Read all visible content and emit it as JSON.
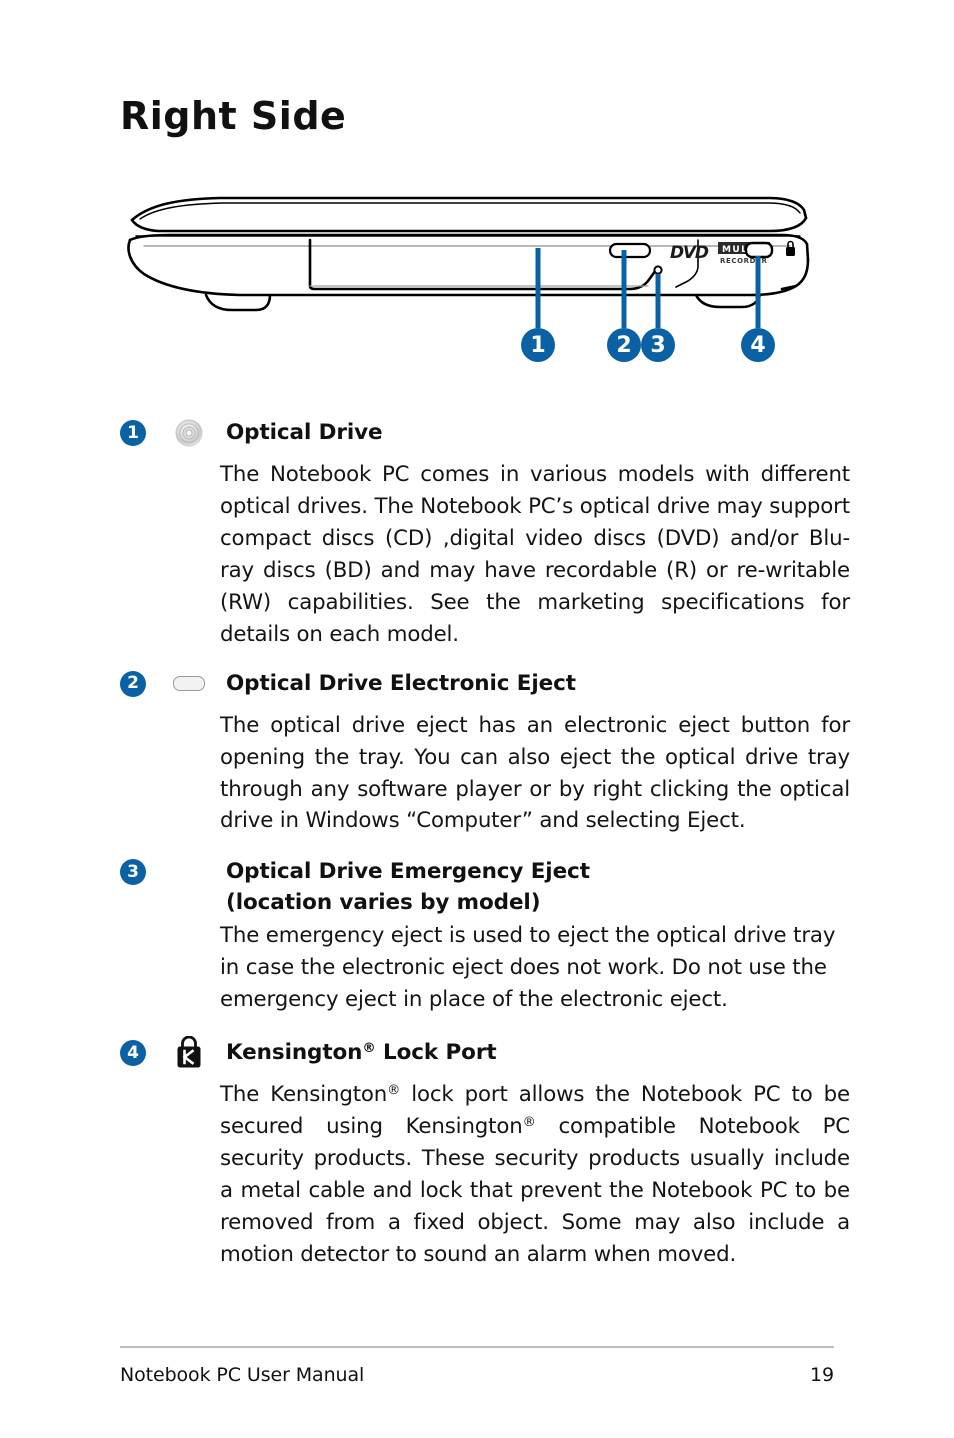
{
  "page": {
    "title": "Right Side"
  },
  "illustration": {
    "name": "notebook-right-side-diagram",
    "drive_logo_primary": "DVD",
    "drive_logo_secondary": "MULTI",
    "drive_logo_tertiary": "RECORDER",
    "callouts": [
      {
        "number": "1",
        "target": "optical-drive"
      },
      {
        "number": "2",
        "target": "optical-drive-electronic-eject"
      },
      {
        "number": "3",
        "target": "optical-drive-emergency-eject"
      },
      {
        "number": "4",
        "target": "kensington-lock-port"
      }
    ],
    "accent_color": "#0a61a4"
  },
  "items": [
    {
      "number": "1",
      "icon": "optical-disc-icon",
      "heading": "Optical Drive",
      "heading_line2": "",
      "body": "The Notebook PC comes in various models with different optical drives. The Notebook PC’s optical drive may support compact discs (CD) ,digital video discs (DVD) and/or Blu-ray discs (BD) and may have recordable (R) or re-writable (RW) capabilities. See the marketing specifications for details on each model."
    },
    {
      "number": "2",
      "icon": "eject-button-icon",
      "heading": "Optical Drive Electronic Eject",
      "heading_line2": "",
      "body": "The optical drive eject has an electronic eject button for opening the tray. You can also eject the optical drive tray through any software player or by right clicking the optical drive in Windows “Computer” and selecting Eject."
    },
    {
      "number": "3",
      "icon": "",
      "heading": "Optical Drive Emergency Eject",
      "heading_line2": "(location varies by model)",
      "body": "The emergency eject is used to eject the optical drive tray in case the electronic eject does not work. Do not use the emergency eject in place of the electronic eject."
    },
    {
      "number": "4",
      "icon": "kensington-lock-icon",
      "heading_pre": "Kensington",
      "heading_sup": "®",
      "heading_post": " Lock Port",
      "heading_line2": "",
      "body_pre": "The Kensington",
      "body_sup1": "®",
      "body_mid": " lock port allows the Notebook PC to be secured using Kensington",
      "body_sup2": "®",
      "body_post": " compatible Notebook PC security products. These security products usually include a metal cable and lock that prevent the Notebook PC to be removed from a fixed object. Some may also include a motion detector to sound an alarm when moved."
    }
  ],
  "footer": {
    "manual_name": "Notebook PC User Manual",
    "page_number": "19"
  }
}
